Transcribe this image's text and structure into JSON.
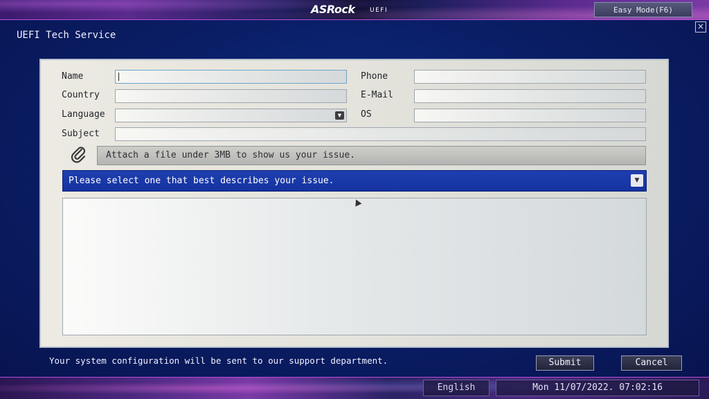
{
  "header": {
    "logo": "ASRock",
    "logo_sub": "UEFI",
    "easy_mode": "Easy Mode(F6)"
  },
  "page": {
    "title": "UEFI Tech Service",
    "close_icon": "×"
  },
  "form": {
    "name_label": "Name",
    "country_label": "Country",
    "language_label": "Language",
    "subject_label": "Subject",
    "phone_label": "Phone",
    "email_label": "E-Mail",
    "os_label": "OS",
    "name_value": "",
    "country_value": "",
    "language_value": "",
    "subject_value": "",
    "phone_value": "",
    "email_value": "",
    "os_value": "",
    "attach_text": "Attach a file under 3MB to show us your issue.",
    "issue_select": "Please select one that best describes your issue.",
    "description_value": ""
  },
  "footer": {
    "message": "Your system configuration will be sent to our support department.",
    "submit": "Submit",
    "cancel": "Cancel"
  },
  "statusbar": {
    "language": "English",
    "datetime": "Mon 11/07/2022. 07:02:16"
  },
  "icons": {
    "close": "close-icon",
    "dropdown": "chevron-down-icon",
    "attach": "paperclip-icon"
  },
  "colors": {
    "accent_blue": "#1636a6",
    "panel_bg": "#e6e5de",
    "background": "#0a1e66",
    "border_glow": "#b74fd8"
  }
}
